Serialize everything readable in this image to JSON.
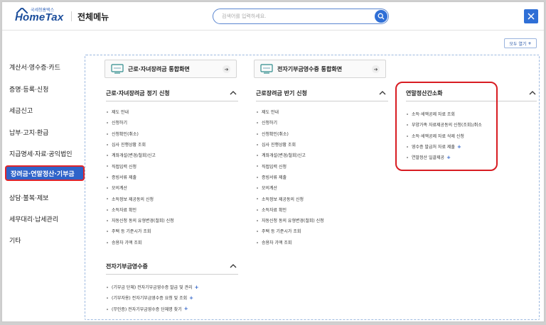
{
  "header": {
    "logo_small": "국세청홈택스",
    "logo_big": "HomeTax",
    "title": "전체메뉴",
    "search_placeholder": "검색어를 입력하세요."
  },
  "open_all_label": "모두 열기",
  "sidebar": {
    "items": [
      {
        "label": "계산서·영수증·카드"
      },
      {
        "label": "증명·등록·신청"
      },
      {
        "label": "세금신고"
      },
      {
        "label": "납부·고지·환급"
      },
      {
        "label": "지급명세·자료·공익법인"
      },
      {
        "label": "장려금·연말정산·기부금"
      },
      {
        "label": "상담·불복·제보"
      },
      {
        "label": "세무대리·납세관리"
      },
      {
        "label": "기타"
      }
    ]
  },
  "shortcuts": [
    {
      "label": "근로·자녀장려금 통합화면"
    },
    {
      "label": "전자기부금영수증 통합화면"
    }
  ],
  "sections": {
    "col1_top": {
      "title": "근로·자녀장려금 정기 신청",
      "items": [
        "제도 안내",
        "신청하기",
        "신청확인(취소)",
        "심사 진행상황 조회",
        "계좌개설(변경/철회)신고",
        "직접입력 신청",
        "증빙서류 제출",
        "모의계산",
        "소득정보 제공동의 신청",
        "소득자료 확인",
        "자동신청 동의 유형변경(철회) 신청",
        "주택 등 기준시가 조회",
        "승용차 가액 조회"
      ]
    },
    "col1_bottom": {
      "title": "전자기부금영수증",
      "items": [
        {
          "text": "(기부금 단체) 전자기부금영수증 발급 및 관리",
          "plus": "+"
        },
        {
          "text": "(기부자용) 전자기부금영수증 요청 및 조회",
          "plus": "+"
        },
        {
          "text": "(무인증) 전자기부금영수증 단체명 찾기",
          "plus": "+"
        }
      ]
    },
    "col2": {
      "title": "근로장려금 반기 신청",
      "items": [
        "제도 안내",
        "신청하기",
        "신청확인(취소)",
        "심사 진행상황 조회",
        "계좌개설(변경/철회)신고",
        "직접입력 신청",
        "증빙서류 제출",
        "모의계산",
        "소득정보 제공동의 신청",
        "소득자료 확인",
        "자동신청 동의 유형변경(철회) 신청",
        "주택 등 기준시가 조회",
        "승용차 가액 조회"
      ]
    },
    "col3": {
      "title": "연말정산간소화",
      "items": [
        {
          "text": "소득·세액공제 자료 조회",
          "plus": ""
        },
        {
          "text": "부양가족 자료제공동의 신청(조회)/취소",
          "plus": ""
        },
        {
          "text": "소득·세액공제 자료 삭제 신청",
          "plus": ""
        },
        {
          "text": "영수증 발급처 자료 제출",
          "plus": "+"
        },
        {
          "text": "연말정산 일괄제공",
          "plus": "+"
        }
      ]
    }
  },
  "colors": {
    "accent": "#2f63c9",
    "highlight_border": "#d81c22"
  }
}
